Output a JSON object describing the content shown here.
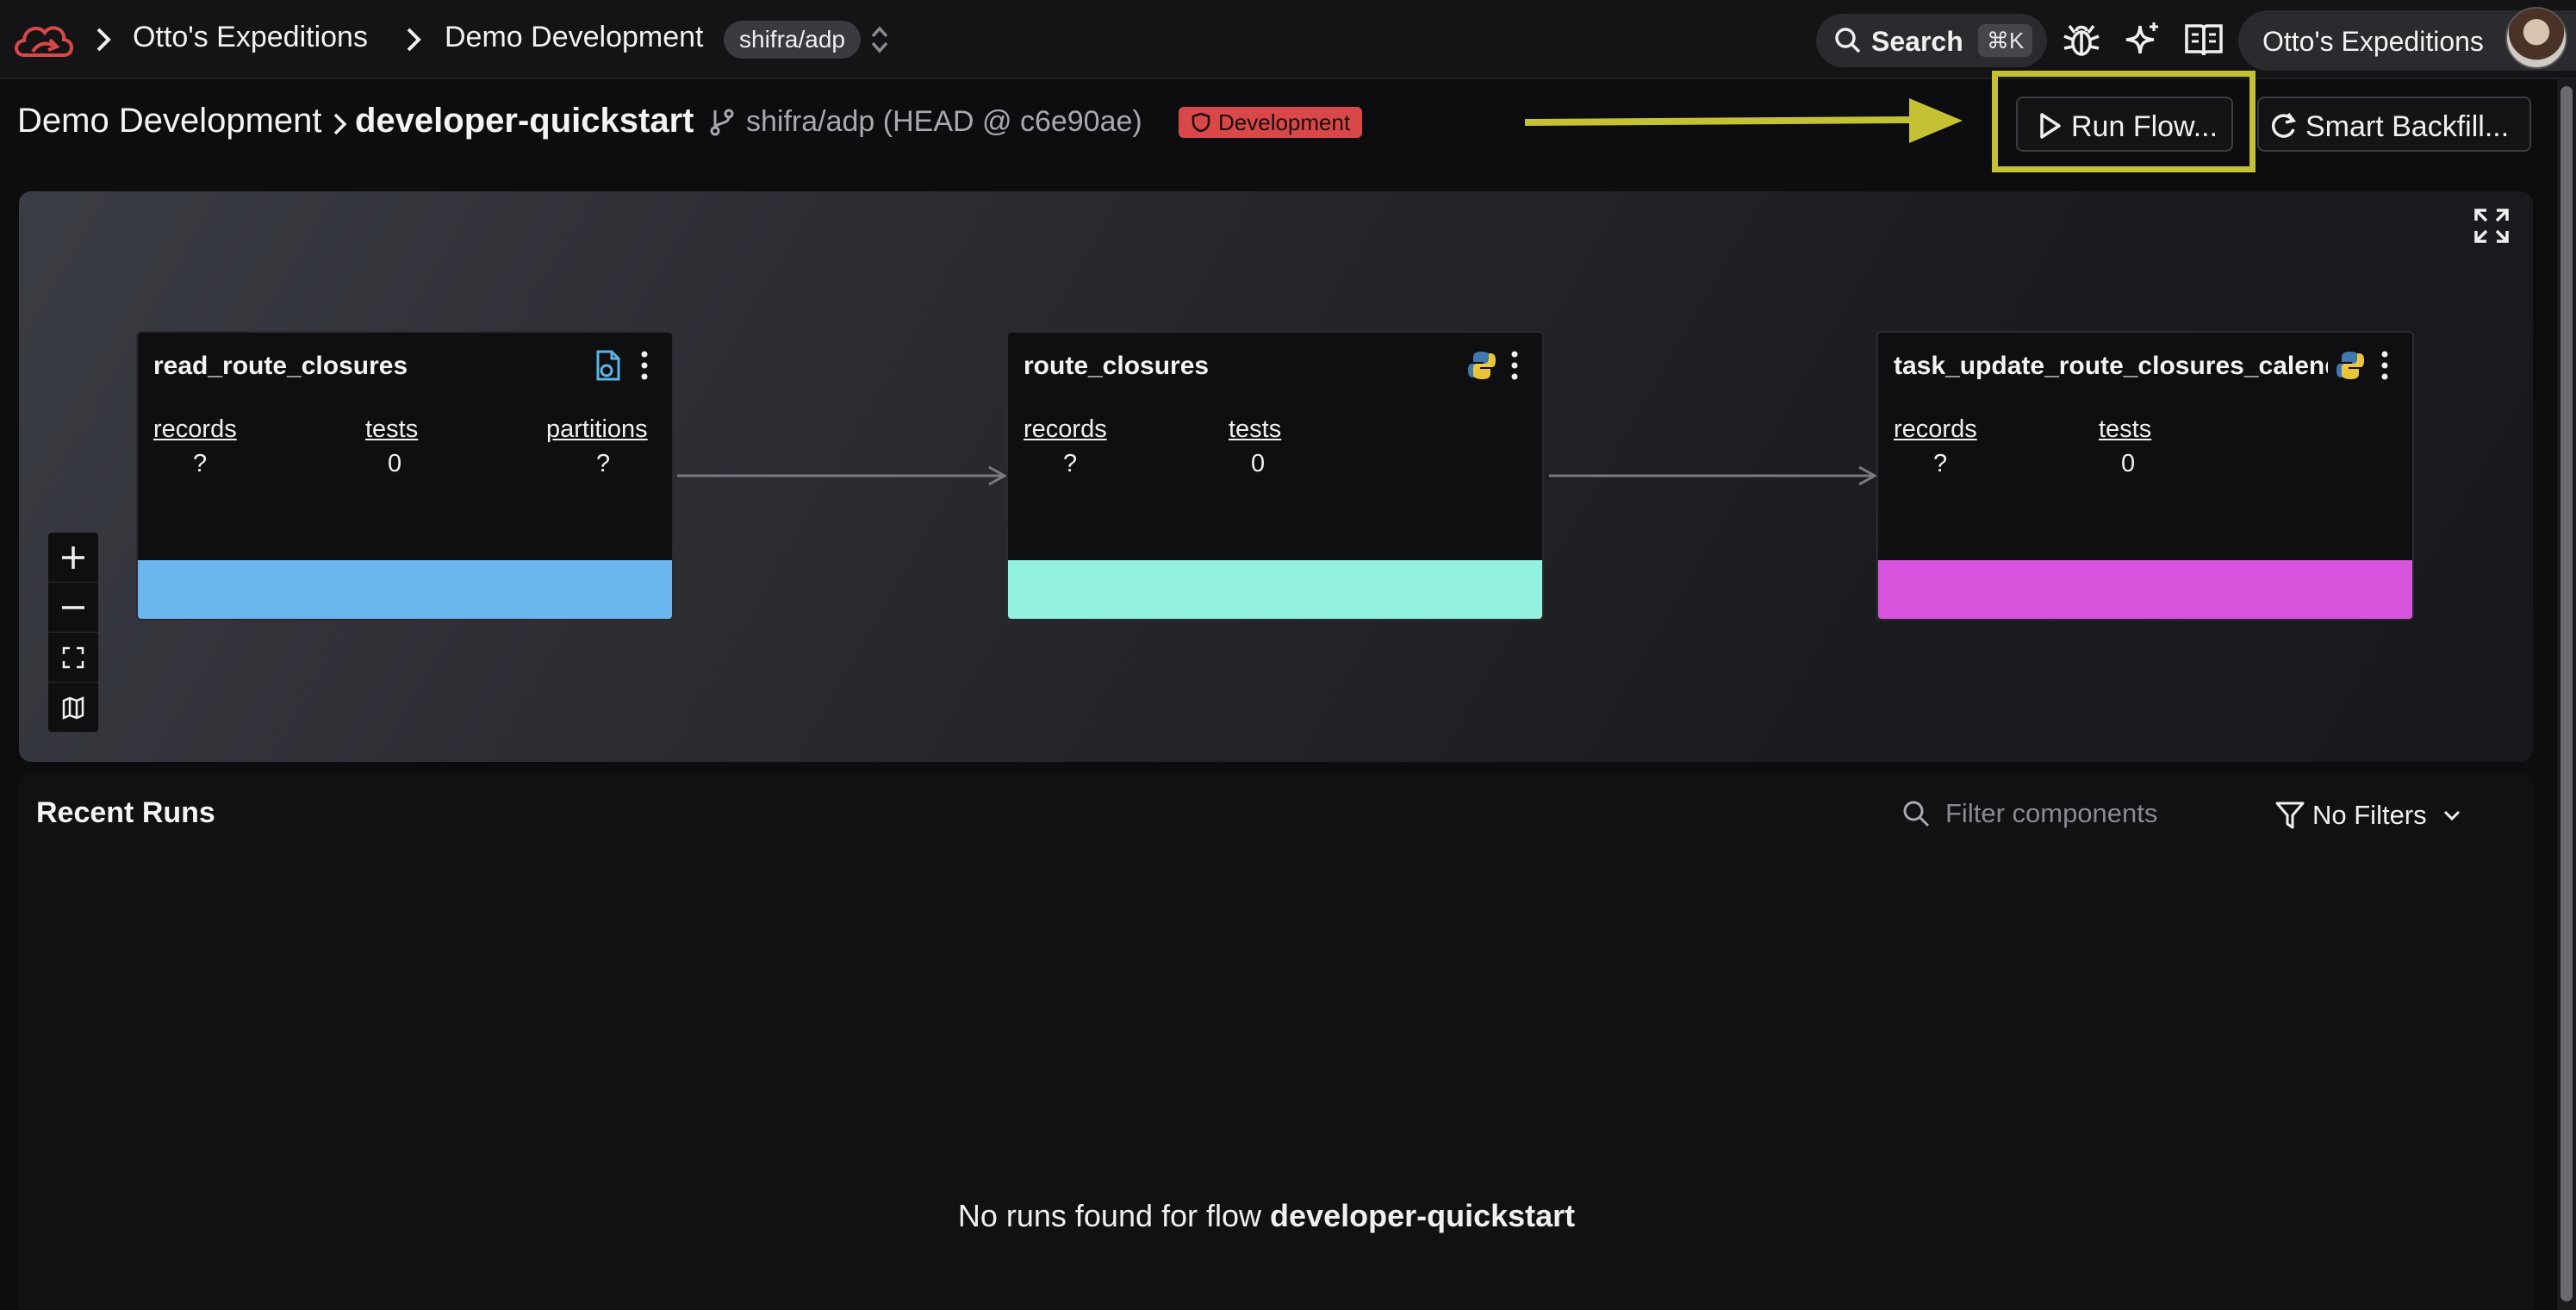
{
  "nav": {
    "breadcrumb_org": "Otto's Expeditions",
    "breadcrumb_project": "Demo Development",
    "branch": "shifra/adp",
    "search_label": "Search",
    "search_shortcut": "⌘K",
    "org_menu": "Otto's Expeditions"
  },
  "header": {
    "project": "Demo Development",
    "flow": "developer-quickstart",
    "branch_ref": "shifra/adp (HEAD @ c6e90ae)",
    "environment": "Development",
    "run_flow": "Run Flow...",
    "smart_backfill": "Smart Backfill..."
  },
  "graph": {
    "nodes": [
      {
        "title": "read_route_closures",
        "icon": "data-source-icon",
        "color": "#6bb6ee",
        "stats": [
          {
            "label": "records",
            "value": "?"
          },
          {
            "label": "tests",
            "value": "0"
          },
          {
            "label": "partitions",
            "value": "?"
          }
        ]
      },
      {
        "title": "route_closures",
        "icon": "python-icon",
        "color": "#93f2df",
        "stats": [
          {
            "label": "records",
            "value": "?"
          },
          {
            "label": "tests",
            "value": "0"
          }
        ]
      },
      {
        "title": "task_update_route_closures_calendar",
        "icon": "python-icon",
        "color": "#d755dc",
        "stats": [
          {
            "label": "records",
            "value": "?"
          },
          {
            "label": "tests",
            "value": "0"
          }
        ]
      }
    ]
  },
  "runs": {
    "title": "Recent Runs",
    "filter_placeholder": "Filter components",
    "filters_label": "No Filters",
    "empty_prefix": "No runs found for flow ",
    "empty_flow": "developer-quickstart"
  },
  "colors": {
    "annotation": "#c4c232",
    "environment_badge": "#d94848",
    "logo": "#d94848"
  }
}
